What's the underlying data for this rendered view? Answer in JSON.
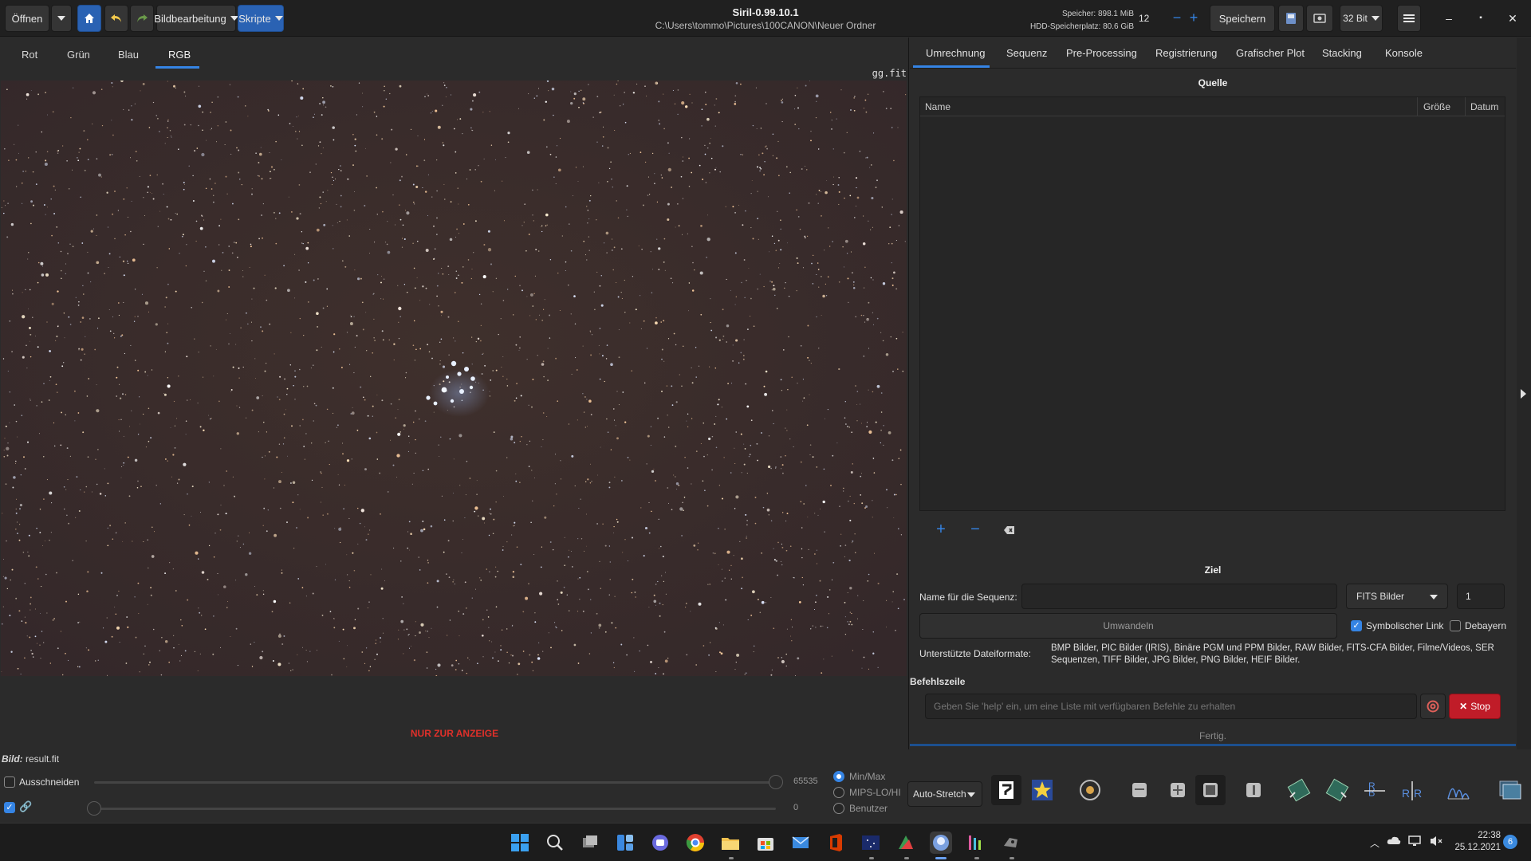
{
  "header": {
    "open_label": "Öffnen",
    "image_processing_label": "Bildbearbeitung",
    "scripts_label": "Skripte",
    "app_title": "Siril-0.99.10.1",
    "path": "C:\\Users\\tommo\\Pictures\\100CANON\\Neuer Ordner",
    "memory": "Speicher: 898.1 MiB",
    "disk": "HDD-Speicherplatz: 80.6 GiB",
    "thread_count": "12",
    "save_label": "Speichern",
    "bit_depth": "32 Bit"
  },
  "left_panel": {
    "tabs": [
      {
        "label": "Rot"
      },
      {
        "label": "Grün"
      },
      {
        "label": "Blau"
      },
      {
        "label": "RGB"
      }
    ],
    "active_tab": "RGB",
    "filename": "gg.fit",
    "display_only_notice": "NUR ZUR ANZEIGE"
  },
  "right_panel": {
    "tabs": [
      {
        "label": "Umrechnung"
      },
      {
        "label": "Sequenz"
      },
      {
        "label": "Pre-Processing"
      },
      {
        "label": "Registrierung"
      },
      {
        "label": "Grafischer Plot"
      },
      {
        "label": "Stacking"
      },
      {
        "label": "Konsole"
      }
    ],
    "source_title": "Quelle",
    "columns": [
      "Name",
      "Größe",
      "Datum"
    ],
    "target_title": "Ziel",
    "sequence_name_label": "Name für die Sequenz:",
    "sequence_name_value": "",
    "output_format": "FITS Bilder",
    "start_index": "1",
    "convert_label": "Umwandeln",
    "symlink_label": "Symbolischer Link",
    "symlink_checked": true,
    "debayer_label": "Debayern",
    "debayer_checked": false,
    "supported_formats_label": "Unterstützte Dateiformate:",
    "supported_formats_text": "BMP Bilder, PIC Bilder (IRIS), Binäre PGM und PPM Bilder, RAW Bilder, FITS-CFA Bilder, Filme/Videos, SER Sequenzen, TIFF Bilder, JPG Bilder, PNG Bilder, HEIF Bilder.",
    "command_line_title": "Befehlszeile",
    "command_placeholder": "Geben Sie 'help' ein, um eine Liste mit verfügbaren Befehle zu erhalten",
    "stop_label": "Stop",
    "status": "Fertig."
  },
  "bottom": {
    "image_label": "Bild:",
    "image_name": "result.fit",
    "crop_label": "Ausschneiden",
    "high_value": "65535",
    "low_value": "0",
    "high_fraction": 1.0,
    "low_fraction": 0.0,
    "radio_options": [
      "Min/Max",
      "MIPS-LO/HI",
      "Benutzer"
    ],
    "selected_radio": "Min/Max",
    "stretch_mode": "Auto-Stretch"
  },
  "taskbar": {
    "time": "22:38",
    "date": "25.12.2021",
    "notification_count": "6"
  },
  "colors": {
    "accent": "#3584e4",
    "stop_red": "#e01b24",
    "notice_red": "#e0302a"
  }
}
